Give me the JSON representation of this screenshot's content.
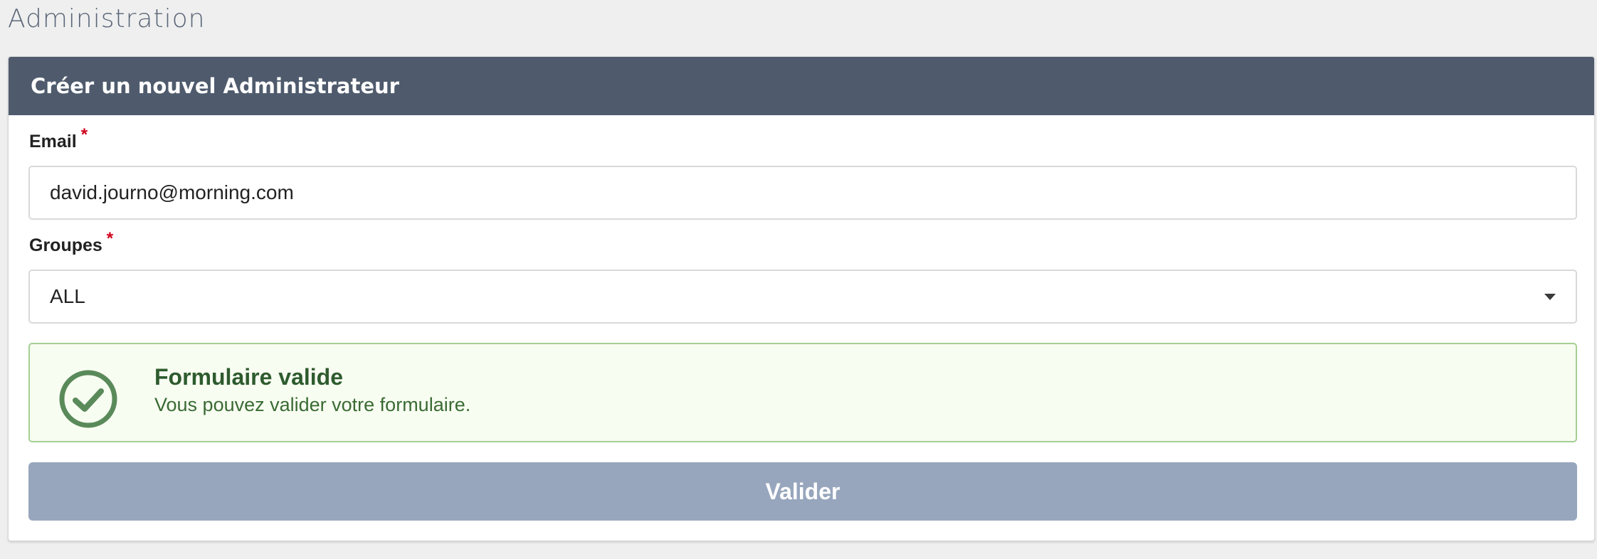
{
  "page": {
    "title": "Administration"
  },
  "card": {
    "header_title": "Créer un nouvel Administrateur"
  },
  "form": {
    "email": {
      "label": "Email",
      "required_marker": "*",
      "value": "david.journo@morning.com"
    },
    "groups": {
      "label": "Groupes",
      "required_marker": "*",
      "selected_value": "ALL"
    },
    "validation_alert": {
      "title": "Formulaire valide",
      "message": "Vous pouvez valider votre formulaire.",
      "icon": "check-circle-icon"
    },
    "submit_label": "Valider"
  },
  "colors": {
    "header_bg": "#4f5b6d",
    "success_border": "#a6cf94",
    "success_bg": "#f8fdf2",
    "success_text": "#2e5b2e",
    "button_bg": "#97a6bd",
    "required": "#d0021b"
  }
}
